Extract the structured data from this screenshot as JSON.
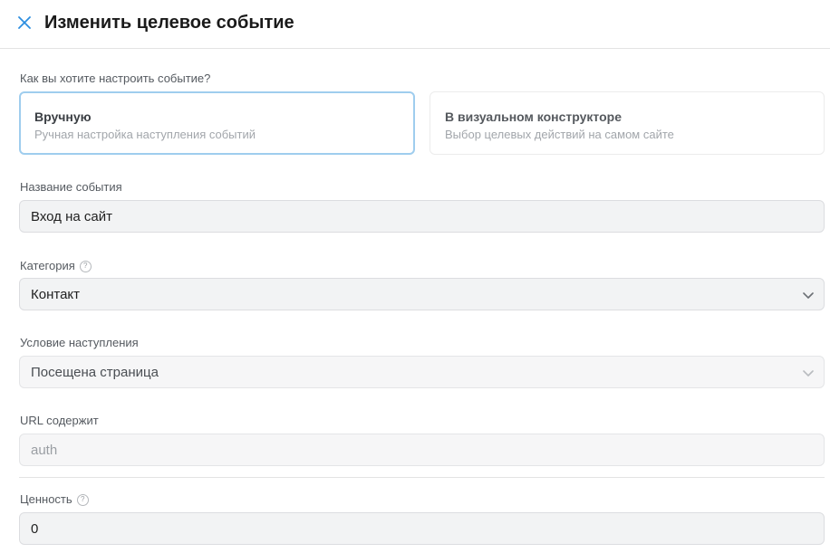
{
  "header": {
    "title": "Изменить целевое событие",
    "close_icon": "close-icon"
  },
  "setup": {
    "question": "Как вы хотите настроить событие?",
    "options": [
      {
        "title": "Вручную",
        "subtitle": "Ручная настройка наступления событий",
        "selected": true
      },
      {
        "title": "В визуальном конструкторе",
        "subtitle": "Выбор целевых действий на самом сайте",
        "selected": false
      }
    ]
  },
  "event_name": {
    "label": "Название события",
    "value": "Вход на сайт"
  },
  "category": {
    "label": "Категория",
    "help_icon": "question-circle-icon",
    "value": "Контакт"
  },
  "condition": {
    "label": "Условие наступления",
    "value": "Посещена страница"
  },
  "url": {
    "label": "URL содержит",
    "value": "auth"
  },
  "value_field": {
    "label": "Ценность",
    "help_icon": "question-circle-icon",
    "value": "0"
  },
  "colors": {
    "accent": "#2d8ee0",
    "selected_border": "#9fcdee",
    "field_bg": "#f2f3f4"
  }
}
